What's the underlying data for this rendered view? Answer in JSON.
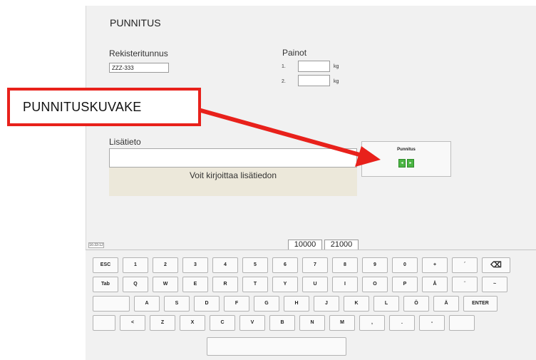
{
  "form": {
    "title": "PUNNITUS",
    "reg_label": "Rekisteritunnus",
    "reg_value": "ZZZ-333",
    "weights_label": "Painot",
    "weight_rows": [
      {
        "num": "1.",
        "value": "",
        "unit": "kg"
      },
      {
        "num": "2.",
        "value": "",
        "unit": "kg"
      }
    ],
    "notes_label": "Lisätieto",
    "notes_value": "",
    "notes_hint": "Voit kirjoittaa lisätiedon"
  },
  "weigh_button": {
    "label": "Punnitus",
    "icon": "scale-icon",
    "icon_color": "#4bb543"
  },
  "callout": {
    "text": "PUNNITUSKUVAKE",
    "border_color": "#e8211b"
  },
  "status": {
    "time": "16:33:12",
    "values": [
      "10000",
      "21000"
    ]
  },
  "keyboard": {
    "rows": [
      [
        "ESC",
        "1",
        "2",
        "3",
        "4",
        "5",
        "6",
        "7",
        "8",
        "9",
        "0",
        "+",
        "´",
        "backspace"
      ],
      [
        "Tab",
        "Q",
        "W",
        "E",
        "R",
        "T",
        "Y",
        "U",
        "I",
        "O",
        "P",
        "Å",
        "¨",
        "~"
      ],
      [
        "",
        "A",
        "S",
        "D",
        "F",
        "G",
        "H",
        "J",
        "K",
        "L",
        "Ö",
        "Ä",
        "ENTER"
      ],
      [
        "",
        "<",
        "Z",
        "X",
        "C",
        "V",
        "B",
        "N",
        "M",
        ",",
        ".",
        "-",
        ""
      ],
      [
        ""
      ]
    ]
  }
}
